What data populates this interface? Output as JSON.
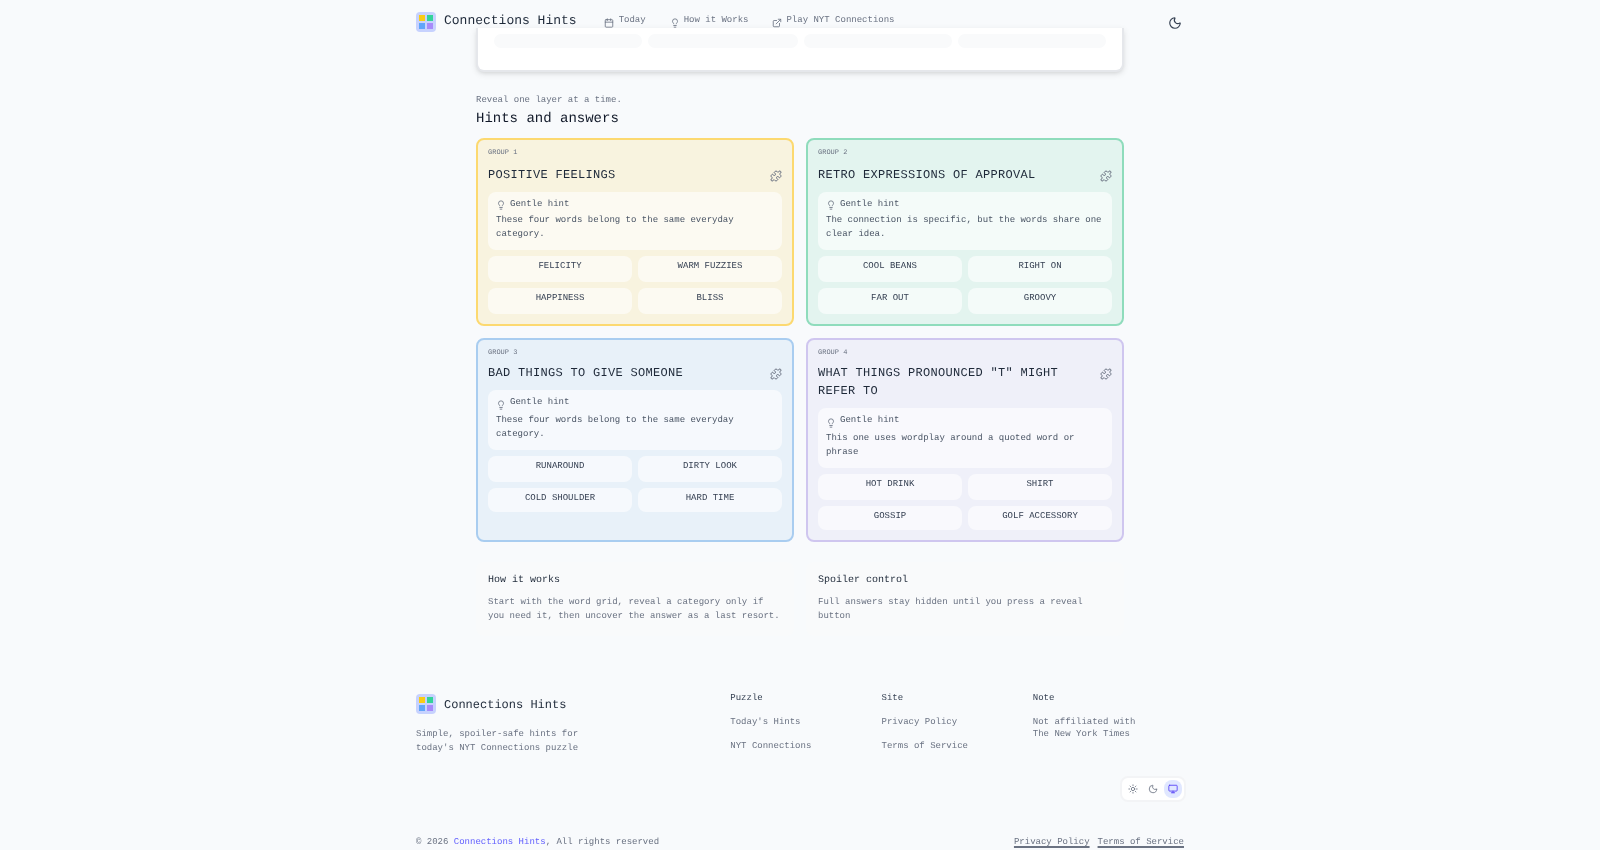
{
  "header": {
    "brand": "Connections Hints",
    "nav": [
      {
        "kind": "calendar",
        "label": "Today"
      },
      {
        "kind": "bulb",
        "label": "How it Works"
      },
      {
        "kind": "external",
        "label": "Play NYT Connections"
      }
    ]
  },
  "hints": {
    "intro": "Reveal one layer at a time.",
    "title": "Hints and answers",
    "groups": [
      {
        "label": "GROUP 1",
        "title": "POSITIVE FEELINGS",
        "color": "#fcd970",
        "hint_label": "Gentle hint",
        "hint": "These four words belong to the same everyday category.",
        "words": [
          "FELICITY",
          "WARM FUZZIES",
          "HAPPINESS",
          "BLISS"
        ]
      },
      {
        "label": "GROUP 2",
        "title": "RETRO EXPRESSIONS OF APPROVAL",
        "color": "#8fdcbc",
        "hint_label": "Gentle hint",
        "hint": "The connection is specific, but the words share one clear idea.",
        "words": [
          "COOL BEANS",
          "RIGHT ON",
          "FAR OUT",
          "GROOVY"
        ]
      },
      {
        "label": "GROUP 3",
        "title": "BAD THINGS TO GIVE SOMEONE",
        "color": "#a9cdf0",
        "hint_label": "Gentle hint",
        "hint": "These four words belong to the same everyday category.",
        "words": [
          "RUNAROUND",
          "DIRTY LOOK",
          "COLD SHOULDER",
          "HARD TIME"
        ]
      },
      {
        "label": "GROUP 4",
        "title": "WHAT THINGS PRONOUNCED \"T\" MIGHT REFER TO",
        "color": "#cfc6ef",
        "hint_label": "Gentle hint",
        "hint": "This one uses wordplay around a quoted word or phrase",
        "words": [
          "HOT DRINK",
          "SHIRT",
          "GOSSIP",
          "GOLF ACCESSORY"
        ]
      }
    ]
  },
  "info": [
    {
      "title": "How it works",
      "text": "Start with the word grid, reveal a category only if you need it, then uncover the answer as a last resort."
    },
    {
      "title": "Spoiler control",
      "text": "Full answers stay hidden until you press a reveal button"
    }
  ],
  "footer": {
    "brand": "Connections Hints",
    "tagline": "Simple, spoiler-safe hints for today's NYT Connections puzzle",
    "columns": [
      {
        "heading": "Puzzle",
        "links": [
          "Today's Hints",
          "NYT Connections"
        ]
      },
      {
        "heading": "Site",
        "links": [
          "Privacy Policy",
          "Terms of Service"
        ]
      },
      {
        "heading": "Note",
        "text": "Not affiliated with The New York Times"
      }
    ],
    "theme": [
      {
        "kind": "light",
        "selected": false
      },
      {
        "kind": "dark",
        "selected": false
      },
      {
        "kind": "system",
        "selected": true
      }
    ],
    "copyright_prefix": "© 2026",
    "copyright_link": "Connections Hints",
    "copyright_suffix": ", All rights reserved",
    "legal": [
      "Privacy Policy",
      "Terms of Service"
    ]
  }
}
